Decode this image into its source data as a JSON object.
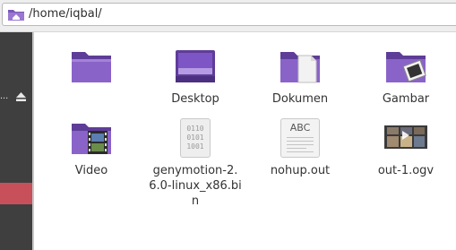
{
  "location": {
    "path": "/home/iqbal/"
  },
  "sidebar": {
    "truncated_label": "..."
  },
  "files": [
    {
      "name": "",
      "icon": "folder-icon"
    },
    {
      "name": "Desktop",
      "icon": "folder-desktop-icon"
    },
    {
      "name": "Dokumen",
      "icon": "folder-documents-icon"
    },
    {
      "name": "Gambar",
      "icon": "folder-pictures-icon"
    },
    {
      "name": "Video",
      "icon": "folder-videos-icon"
    },
    {
      "name": "genymotion-2.6.0-linux_x86.bin",
      "icon": "binary-file-icon"
    },
    {
      "name": "nohup.out",
      "icon": "text-file-icon"
    },
    {
      "name": "out-1.ogv",
      "icon": "video-thumbnail-icon"
    }
  ],
  "binary_glyph": [
    "0110",
    "0101",
    "1001"
  ],
  "text_glyph": "ABC",
  "colors": {
    "folder": "#7c57b8",
    "sidebar": "#3f3f3f",
    "sidebar_selected": "#c8505a"
  }
}
